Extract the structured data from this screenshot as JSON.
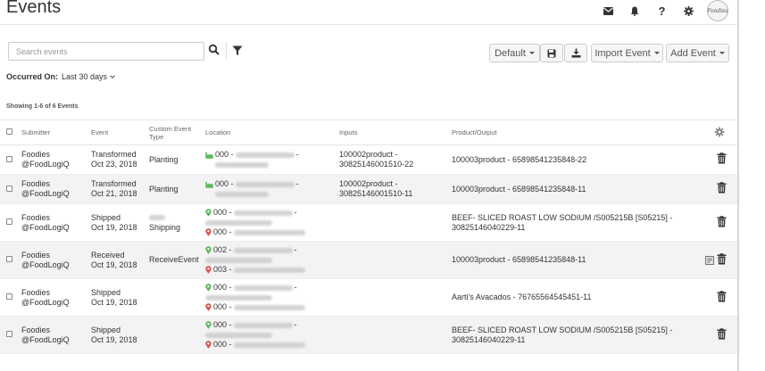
{
  "header": {
    "title": "Events",
    "icons": [
      "envelope-icon",
      "bell-icon",
      "help-icon",
      "gear-icon"
    ],
    "avatar_text": "Foodies"
  },
  "toolbar": {
    "search_placeholder": "Search events",
    "default_label": "Default",
    "import_label": "Import Event",
    "add_label": "Add Event"
  },
  "filter": {
    "label": "Occurred On:",
    "value": "Last 30 days"
  },
  "showing": "Showing 1-6 of 6 Events",
  "columns": {
    "submitter": "Submitter",
    "event": "Event",
    "custom_type_1": "Custom Event",
    "custom_type_2": "Type",
    "location": "Location",
    "inputs": "Inputs",
    "output": "Product/Output"
  },
  "rows": [
    {
      "submitter_1": "Foodies",
      "submitter_2": "@FoodLogiQ",
      "event": "Transformed",
      "date": "Oct 23, 2018",
      "custom_type": "Planting",
      "loc_1": "000 -",
      "input_1": "100002product -",
      "input_2": "30825146001510-22",
      "output_1": "100003product - 65898541235848-22",
      "output_2": ""
    },
    {
      "submitter_1": "Foodies",
      "submitter_2": "@FoodLogiQ",
      "event": "Transformed",
      "date": "Oct 21, 2018",
      "custom_type": "Planting",
      "loc_1": "000 -",
      "input_1": "100002product -",
      "input_2": "30825146001510-11",
      "output_1": "100003product - 65898541235848-11",
      "output_2": ""
    },
    {
      "submitter_1": "Foodies",
      "submitter_2": "@FoodLogiQ",
      "event": "Shipped",
      "date": "Oct 19, 2018",
      "custom_type": "Shipping",
      "loc_1": "000 -",
      "loc_2": "000 -",
      "input_1": "",
      "input_2": "",
      "output_1": "BEEF- SLICED ROAST LOW SODIUM /S005215B [S05215] -",
      "output_2": "30825146040229-11"
    },
    {
      "submitter_1": "Foodies",
      "submitter_2": "@FoodLogiQ",
      "event": "Received",
      "date": "Oct 19, 2018",
      "custom_type": "ReceiveEvent",
      "loc_1": "002 -",
      "loc_2": "003 -",
      "input_1": "",
      "input_2": "",
      "output_1": "100003product - 65898541235848-11",
      "output_2": ""
    },
    {
      "submitter_1": "Foodies",
      "submitter_2": "@FoodLogiQ",
      "event": "Shipped",
      "date": "Oct 19, 2018",
      "custom_type": "",
      "loc_1": "000 -",
      "loc_2": "000 -",
      "input_1": "",
      "input_2": "",
      "output_1": "Aarti's Avacados - 76765564545451-11",
      "output_2": ""
    },
    {
      "submitter_1": "Foodies",
      "submitter_2": "@FoodLogiQ",
      "event": "Shipped",
      "date": "Oct 19, 2018",
      "custom_type": "",
      "loc_1": "000 -",
      "loc_2": "000 -",
      "input_1": "",
      "input_2": "",
      "output_1": "BEEF- SLICED ROAST LOW SODIUM /S005215B [S05215] -",
      "output_2": "30825146040229-11"
    }
  ],
  "colors": {
    "green_pin": "#5cb85c",
    "red_pin": "#d9534f"
  }
}
